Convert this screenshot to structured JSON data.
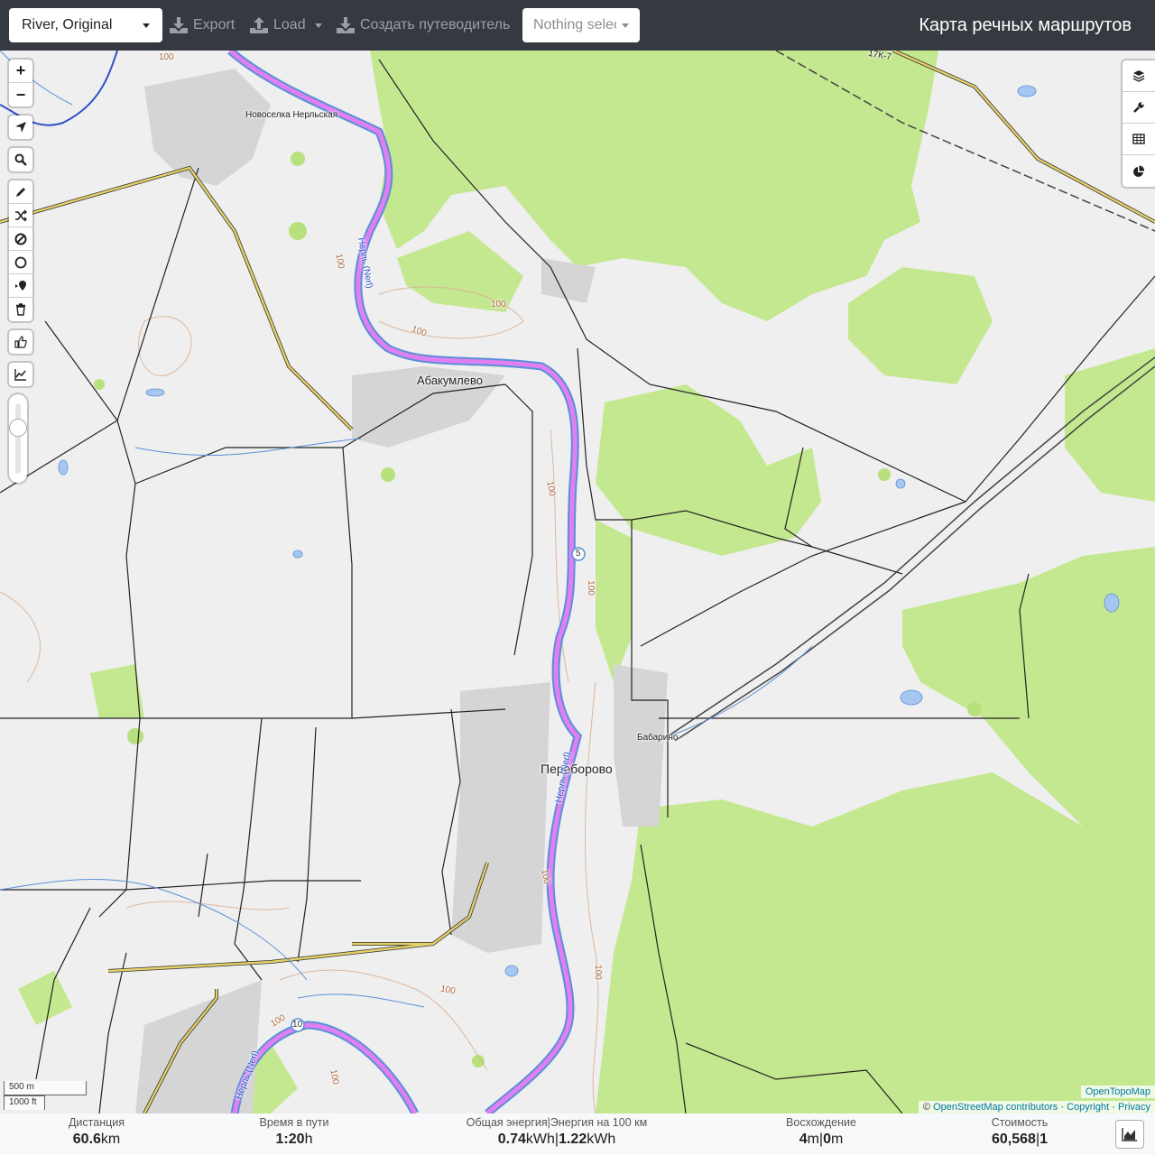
{
  "topbar": {
    "profile": "River, Original",
    "export": "Export",
    "load": "Load",
    "create_guide": "Создать путеводитель",
    "nothing_selected": "Nothing selected",
    "title": "Карта речных маршрутов"
  },
  "map": {
    "places": {
      "novoselka": "Новоселка Нерльская",
      "abakumlevo": "Абакумлево",
      "pereborovo": "Переборово",
      "babarino": "Бабарино"
    },
    "river_labels": [
      "Нерль (Nerl)",
      "Нерль (Nerl)",
      "Нерль (Nerl)"
    ],
    "road_labels": [
      "17К-7"
    ],
    "contours": [
      "100",
      "100",
      "100",
      "100",
      "100",
      "100",
      "100",
      "100",
      "100",
      "100",
      "100"
    ],
    "route_markers": [
      "5",
      "10"
    ],
    "scale": {
      "metric": "500 m",
      "imperial": "1000 ft"
    },
    "attribution": {
      "layer": "OpenTopoMap",
      "copyright_symbol": "©",
      "osm": "OpenStreetMap contributors",
      "sep": "·",
      "copyright": "Copyright",
      "privacy": "Privacy"
    },
    "controls_left": [
      "zoom-in",
      "zoom-out",
      "locate",
      "search",
      "draw",
      "reverse",
      "delete-point",
      "circle",
      "poi",
      "trash",
      "thumbs-up",
      "elevation"
    ],
    "controls_right": [
      "layers",
      "settings",
      "table",
      "chart"
    ],
    "zoom_in_label": "+",
    "zoom_out_label": "−"
  },
  "footer": {
    "distance": {
      "label": "Дистанция",
      "value": "60.6",
      "unit": "km"
    },
    "time": {
      "label": "Время в пути",
      "value": "1:20",
      "unit": "h"
    },
    "energy": {
      "label": "Общая энергия|Энергия на 100 км",
      "value1": "0.74",
      "unit1": "kWh",
      "sep": "|",
      "value2": "1.22",
      "unit2": "kWh"
    },
    "ascent": {
      "label": "Восхождение",
      "value1": "4",
      "unit1": "m",
      "sep": "|",
      "value2": "0",
      "unit2": "m"
    },
    "cost": {
      "label": "Стоимость",
      "value1": "60,568",
      "sep": "|",
      "value2": "1"
    }
  },
  "colors": {
    "topbar": "#343a40",
    "forest": "#c4e88f",
    "route": "#e07ff0",
    "river": "#5b8fd8",
    "road_yellow": "#e6d06a"
  }
}
